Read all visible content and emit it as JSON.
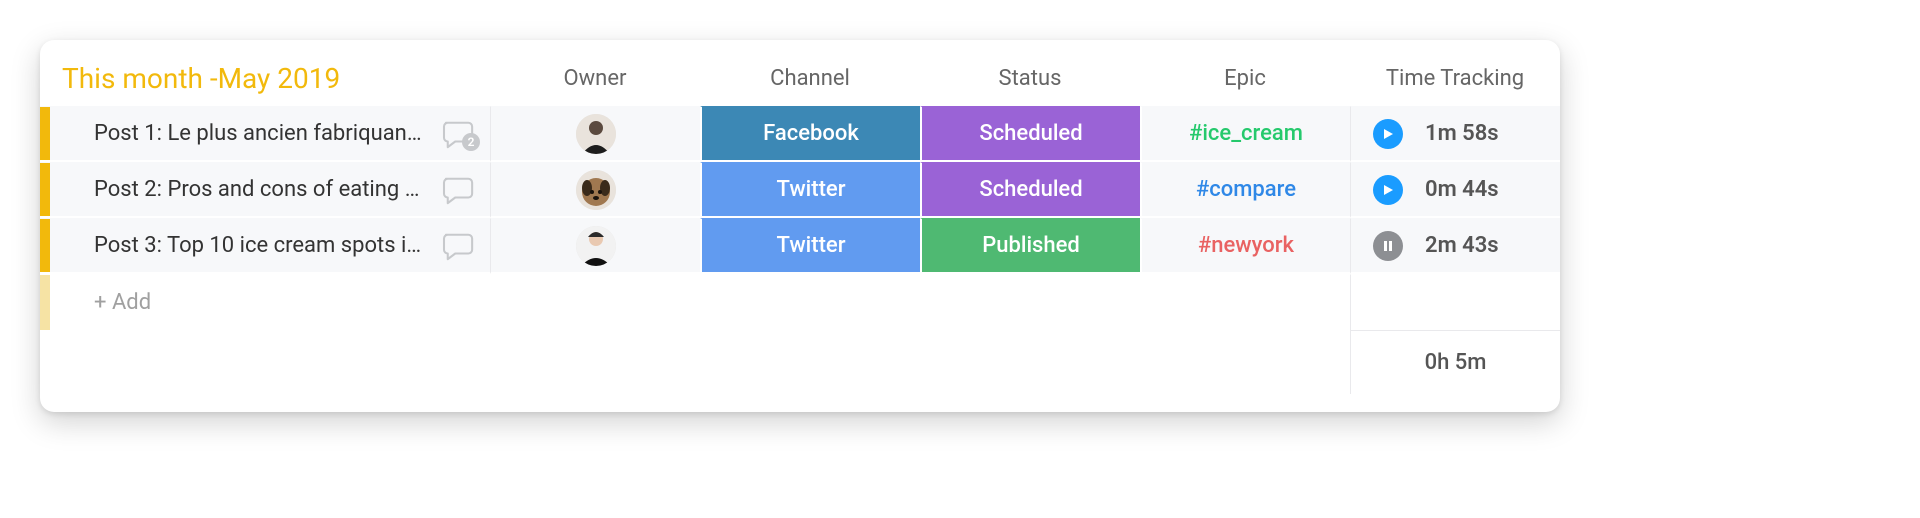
{
  "group": {
    "title": "This month -May 2019"
  },
  "columns": {
    "owner": "Owner",
    "channel": "Channel",
    "status": "Status",
    "epic": "Epic",
    "time_tracking": "Time Tracking"
  },
  "rows": [
    {
      "name": "Post 1: Le plus ancien fabriquant…",
      "chat_count": "2",
      "owner_icon": "avatar-person-dark",
      "channel": {
        "label": "Facebook",
        "style": "pill-fb"
      },
      "status": {
        "label": "Scheduled",
        "style": "pill-purple"
      },
      "epic": {
        "label": "#ice_cream",
        "style": "epic-green"
      },
      "time": {
        "state": "play",
        "value": "1m 58s"
      }
    },
    {
      "name": "Post 2: Pros and cons of eating i…",
      "chat_count": null,
      "owner_icon": "avatar-dog",
      "channel": {
        "label": "Twitter",
        "style": "pill-tw"
      },
      "status": {
        "label": "Scheduled",
        "style": "pill-purple"
      },
      "epic": {
        "label": "#compare",
        "style": "epic-blue"
      },
      "time": {
        "state": "play",
        "value": "0m 44s"
      }
    },
    {
      "name": "Post 3: Top 10 ice cream spots i…",
      "chat_count": null,
      "owner_icon": "avatar-person-light",
      "channel": {
        "label": "Twitter",
        "style": "pill-tw"
      },
      "status": {
        "label": "Published",
        "style": "pill-green"
      },
      "epic": {
        "label": "#newyork",
        "style": "epic-red"
      },
      "time": {
        "state": "pause",
        "value": "2m 43s"
      }
    }
  ],
  "add_label": "+ Add",
  "total_time": "0h 5m"
}
